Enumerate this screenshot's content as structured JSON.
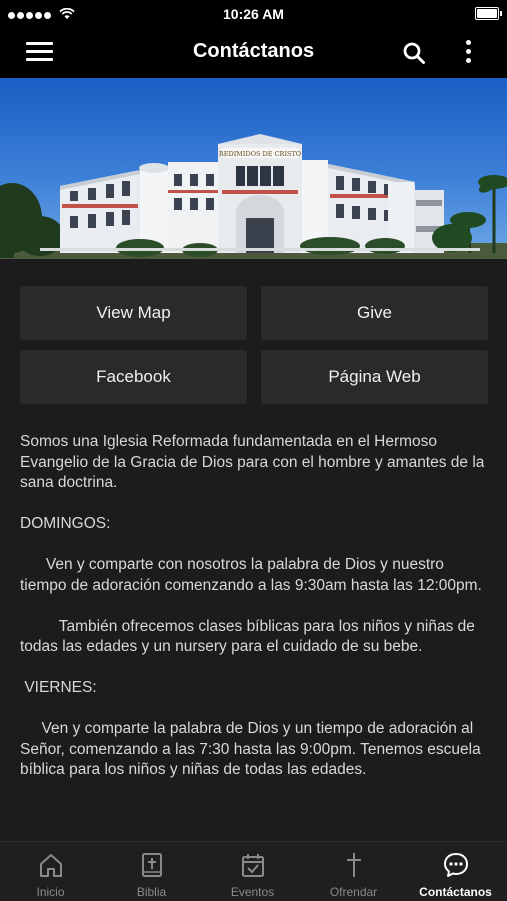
{
  "status_bar": {
    "time": "10:26 AM"
  },
  "header": {
    "title": "Contáctanos"
  },
  "hero": {
    "building_sign": "REDIMIDOS DE CRISTO"
  },
  "buttons": [
    {
      "label": "View Map"
    },
    {
      "label": "Give"
    },
    {
      "label": "Facebook"
    },
    {
      "label": "Página Web"
    }
  ],
  "content": {
    "paragraphs": [
      "Somos una Iglesia Reformada fundamentada en el Hermoso Evangelio de la Gracia de Dios para con el hombre y amantes de la sana doctrina.",
      "DOMINGOS:",
      "      Ven y comparte con nosotros la palabra de Dios y nuestro tiempo de adoración comenzando a las 9:30am hasta las 12:00pm.",
      "         También ofrecemos clases bíblicas para los niños y niñas de todas las edades y un nursery para el cuidado de su bebe.",
      " VIERNES:",
      "     Ven y comparte la palabra de Dios y un tiempo de adoración al Señor, comenzando a las 7:30 hasta las 9:00pm. Tenemos escuela bíblica para los niños y niñas de todas las edades."
    ]
  },
  "tabs": [
    {
      "label": "Inicio",
      "icon": "home-icon",
      "active": false
    },
    {
      "label": "Biblia",
      "icon": "bible-icon",
      "active": false
    },
    {
      "label": "Eventos",
      "icon": "calendar-check-icon",
      "active": false
    },
    {
      "label": "Ofrendar",
      "icon": "cross-icon",
      "active": false
    },
    {
      "label": "Contáctanos",
      "icon": "chat-bubble-icon",
      "active": true
    }
  ],
  "colors": {
    "background": "#1c1c1e",
    "bar": "#000000",
    "button": "#2a2a2c",
    "tab_inactive": "#8a8a8c",
    "tab_active": "#ffffff"
  }
}
